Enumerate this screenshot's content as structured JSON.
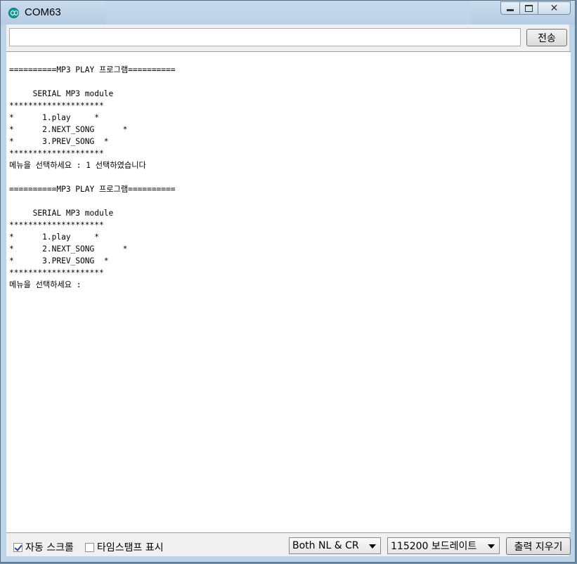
{
  "window": {
    "title": "COM63"
  },
  "toolbar": {
    "input_value": "",
    "send_label": "전송"
  },
  "output": {
    "lines": [
      "==========MP3 PLAY 프로그램==========",
      "",
      "     SERIAL MP3 module",
      "********************",
      "*      1.play     *",
      "*      2.NEXT_SONG      *",
      "*      3.PREV_SONG  *",
      "********************",
      "메뉴을 선택하세요 : 1 선택하였습니다",
      "",
      "==========MP3 PLAY 프로그램==========",
      "",
      "     SERIAL MP3 module",
      "********************",
      "*      1.play     *",
      "*      2.NEXT_SONG      *",
      "*      3.PREV_SONG  *",
      "********************",
      "메뉴을 선택하세요 :"
    ]
  },
  "footer": {
    "autoscroll": {
      "label": "자동 스크롤",
      "checked": true
    },
    "timestamp": {
      "label": "타임스탬프 표시",
      "checked": false
    },
    "line_ending": {
      "value": "Both NL & CR"
    },
    "baud": {
      "value": "115200 보드레이트"
    },
    "clear_label": "출력 지우기"
  }
}
